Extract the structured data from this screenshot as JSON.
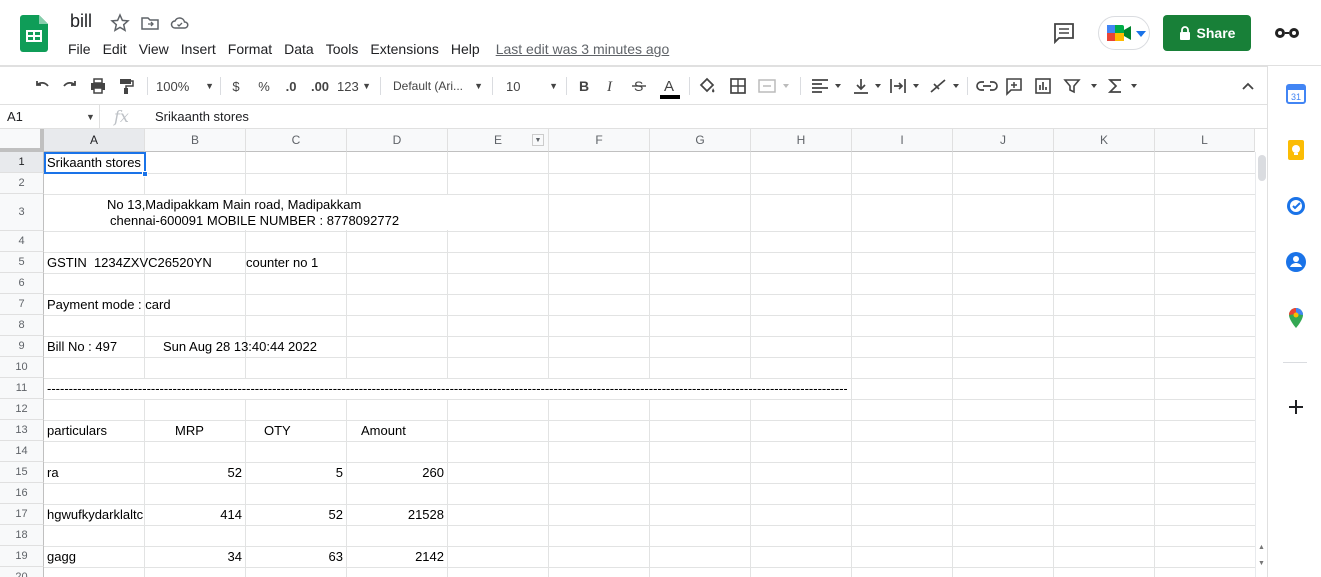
{
  "doc": {
    "title": "bill",
    "last_edit": "Last edit was 3 minutes ago"
  },
  "menu": [
    "File",
    "Edit",
    "View",
    "Insert",
    "Format",
    "Data",
    "Tools",
    "Extensions",
    "Help"
  ],
  "share_label": "Share",
  "toolbar": {
    "zoom": "100%",
    "currency": "$",
    "percent": "%",
    "dec_dec": ".0",
    "inc_dec": ".00",
    "more_formats": "123",
    "font": "Default (Ari...",
    "font_size": "10"
  },
  "formula_bar": {
    "cell_ref": "A1",
    "content": "Srikaanth stores"
  },
  "columns": [
    "A",
    "B",
    "C",
    "D",
    "E",
    "F",
    "G",
    "H",
    "I",
    "J",
    "K",
    "L"
  ],
  "rows": [
    "1",
    "2",
    "3",
    "4",
    "5",
    "6",
    "7",
    "8",
    "9",
    "10",
    "11",
    "12",
    "13",
    "14",
    "15",
    "16",
    "17",
    "18",
    "19",
    "20"
  ],
  "cells": {
    "r1": "Srikaanth stores",
    "r3a": "No 13,Madipakkam Main road, Madipakkam",
    "r3b": "chennai-600091 MOBILE NUMBER : 8778092772",
    "r5a": "GSTIN  1234ZXVC26520YN",
    "r5b": "counter no 1",
    "r7": "Payment mode : card",
    "r9a": "Bill No : 497",
    "r9b": "Sun Aug 28 13:40:44 2022",
    "r11": "--------------------------------------------------------------------------------------------------------------------------------------------------------------------------------------------",
    "hdr": {
      "particulars": "particulars",
      "mrp": "MRP",
      "qty": "OTY",
      "amount": "Amount"
    },
    "items": [
      {
        "name": "ra",
        "mrp": "52",
        "qty": "5",
        "amount": "260"
      },
      {
        "name": "hgwufkydarklaltc",
        "mrp": "414",
        "qty": "52",
        "amount": "21528"
      },
      {
        "name": "gagg",
        "mrp": "34",
        "qty": "63",
        "amount": "2142"
      }
    ]
  },
  "colors": {
    "share": "#188038",
    "selection": "#1a73e8",
    "sheets": "#0f9d58"
  }
}
